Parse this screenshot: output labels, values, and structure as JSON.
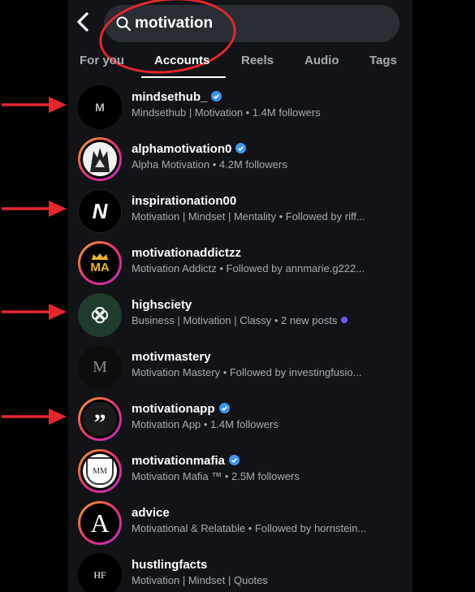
{
  "search": {
    "query": "motivation"
  },
  "tabs": [
    {
      "label": "For you"
    },
    {
      "label": "Accounts"
    },
    {
      "label": "Reels"
    },
    {
      "label": "Audio"
    },
    {
      "label": "Tags"
    }
  ],
  "accounts": [
    {
      "username": "mindsethub_",
      "subtitle": "Mindsethub | Motivation • 1.4M followers",
      "verified": true,
      "avatar_text": "M"
    },
    {
      "username": "alphamotivation0",
      "subtitle": "Alpha Motivation • 4.2M followers",
      "verified": true,
      "avatar_text": ""
    },
    {
      "username": "inspirationation00",
      "subtitle": "Motivation | Mindset | Mentality • Followed by riff...",
      "verified": false,
      "avatar_text": "N"
    },
    {
      "username": "motivationaddictzz",
      "subtitle": "Motivation Addictz • Followed by annmarie.g222...",
      "verified": false,
      "avatar_text": "MA"
    },
    {
      "username": "highsciety",
      "subtitle": "Business | Motivation | Classy • 2 new posts",
      "verified": false,
      "avatar_text": ""
    },
    {
      "username": "motivmastery",
      "subtitle": "Motivation Mastery • Followed by investingfusio...",
      "verified": false,
      "avatar_text": "M"
    },
    {
      "username": "motivationapp",
      "subtitle": "Motivation App • 1.4M followers",
      "verified": true,
      "avatar_text": "”"
    },
    {
      "username": "motivationmafia",
      "subtitle": "Motivation Mafia ™ • 2.5M followers",
      "verified": true,
      "avatar_text": "MM"
    },
    {
      "username": "advice",
      "subtitle": "Motivational & Relatable • Followed by hornstein...",
      "verified": false,
      "avatar_text": "A"
    },
    {
      "username": "hustlingfacts",
      "subtitle": "Motivation | Mindset | Quotes",
      "verified": false,
      "avatar_text": "HF"
    }
  ],
  "colors": {
    "accent_verified": "#3897f0",
    "annotation_red": "#e6262e",
    "new_posts_dot": "#6a5cf5"
  }
}
